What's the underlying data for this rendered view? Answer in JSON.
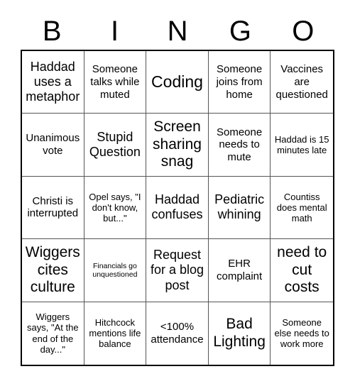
{
  "card": {
    "header_letters": [
      "B",
      "I",
      "N",
      "G",
      "O"
    ],
    "columns": 5,
    "rows": 5,
    "border_color": "#000000",
    "grid_line_color": "#555555",
    "background_color": "#ffffff",
    "text_color": "#000000",
    "cells": [
      {
        "text": "Haddad uses a metaphor",
        "size": "l"
      },
      {
        "text": "Someone talks while muted",
        "size": "m"
      },
      {
        "text": "Coding",
        "size": "xxl"
      },
      {
        "text": "Someone joins from home",
        "size": "m"
      },
      {
        "text": "Vaccines are questioned",
        "size": "m"
      },
      {
        "text": "Unanimous vote",
        "size": "m"
      },
      {
        "text": "Stupid Question",
        "size": "l"
      },
      {
        "text": "Screen sharing snag",
        "size": "xl"
      },
      {
        "text": "Someone needs to mute",
        "size": "m"
      },
      {
        "text": "Haddad is 15 minutes late",
        "size": "s"
      },
      {
        "text": "Christi is interrupted",
        "size": "m"
      },
      {
        "text": "Opel says, \"I don't know, but...\"",
        "size": "s"
      },
      {
        "text": "Haddad confuses",
        "size": "l"
      },
      {
        "text": "Pediatric whining",
        "size": "l"
      },
      {
        "text": "Countiss does mental math",
        "size": "s"
      },
      {
        "text": "Wiggers cites culture",
        "size": "xl"
      },
      {
        "text": "Financials go unquestioned",
        "size": "xs"
      },
      {
        "text": "Request for a blog post",
        "size": "l"
      },
      {
        "text": "EHR complaint",
        "size": "m"
      },
      {
        "text": "need to cut costs",
        "size": "xl"
      },
      {
        "text": "Wiggers says, \"At the end of the day...\"",
        "size": "s"
      },
      {
        "text": "Hitchcock mentions life balance",
        "size": "s"
      },
      {
        "text": "<100% attendance",
        "size": "m"
      },
      {
        "text": "Bad Lighting",
        "size": "xl"
      },
      {
        "text": "Someone else needs to work more",
        "size": "s"
      }
    ]
  }
}
